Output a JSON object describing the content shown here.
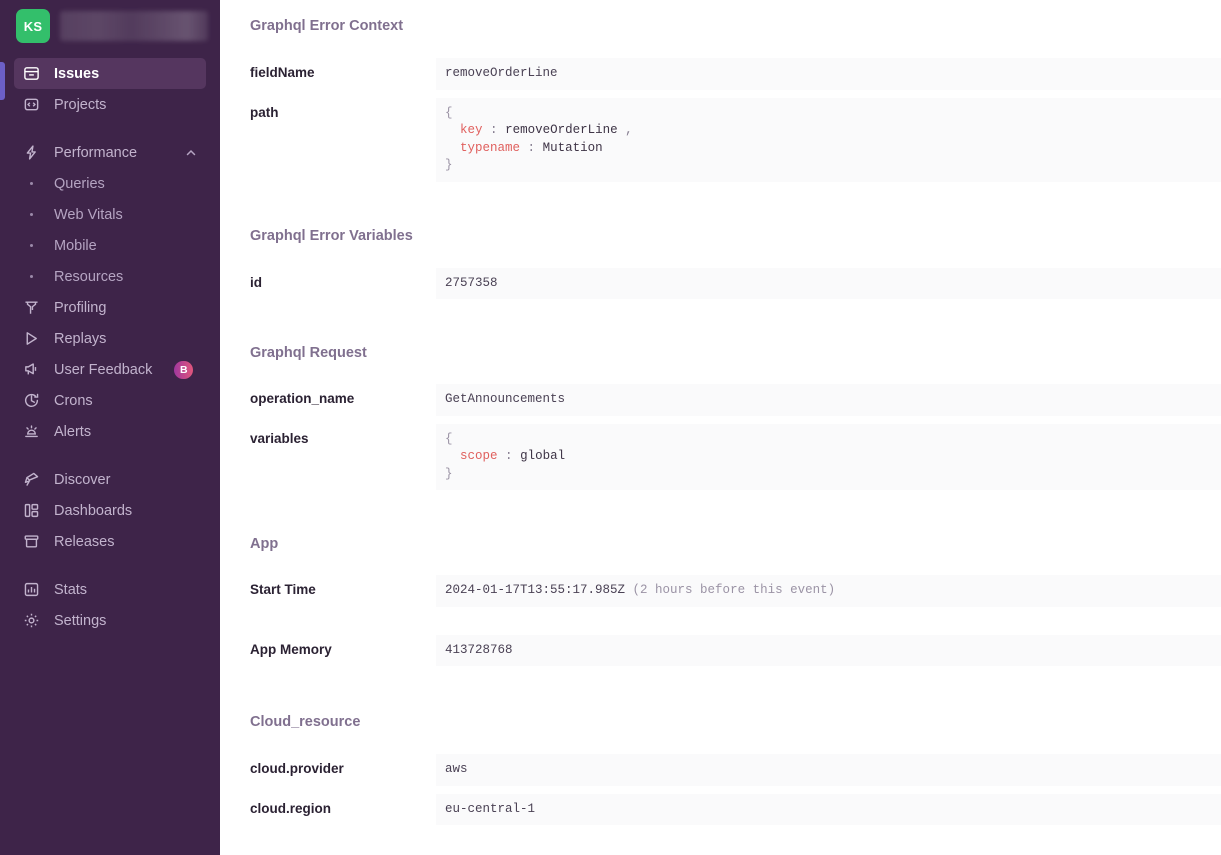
{
  "sidebar": {
    "org": {
      "initials": "KS",
      "name_redacted": ""
    },
    "items": [
      {
        "label": "Issues",
        "icon": "issues-icon",
        "active": true
      },
      {
        "label": "Projects",
        "icon": "projects-icon",
        "active": false
      },
      {
        "label": "Performance",
        "icon": "performance-icon",
        "expanded": true,
        "chevron": "chevron-up-icon"
      },
      {
        "label": "Queries",
        "sub": true
      },
      {
        "label": "Web Vitals",
        "sub": true
      },
      {
        "label": "Mobile",
        "sub": true
      },
      {
        "label": "Resources",
        "sub": true
      },
      {
        "label": "Profiling",
        "icon": "profiling-icon"
      },
      {
        "label": "Replays",
        "icon": "replays-icon"
      },
      {
        "label": "User Feedback",
        "icon": "user-feedback-icon",
        "badge": "B"
      },
      {
        "label": "Crons",
        "icon": "crons-icon"
      },
      {
        "label": "Alerts",
        "icon": "alerts-icon"
      },
      {
        "label": "Discover",
        "icon": "discover-icon"
      },
      {
        "label": "Dashboards",
        "icon": "dashboards-icon"
      },
      {
        "label": "Releases",
        "icon": "releases-icon"
      },
      {
        "label": "Stats",
        "icon": "stats-icon"
      },
      {
        "label": "Settings",
        "icon": "settings-icon"
      }
    ]
  },
  "sections": {
    "graphql_error_context": {
      "title": "Graphql Error Context",
      "field_name_key": "fieldName",
      "field_name_value": "removeOrderLine",
      "path_key": "path",
      "path_lines": {
        "open": "{",
        "l1_key": "key",
        "l1_sep": ":",
        "l1_val": "removeOrderLine",
        "l1_comma": ",",
        "l2_key": "typename",
        "l2_sep": ":",
        "l2_val": "Mutation",
        "close": "}"
      }
    },
    "graphql_error_variables": {
      "title": "Graphql Error Variables",
      "id_key": "id",
      "id_value": "2757358"
    },
    "graphql_request": {
      "title": "Graphql Request",
      "operation_name_key": "operation_name",
      "operation_name_value": "GetAnnouncements",
      "variables_key": "variables",
      "variables_lines": {
        "open": "{",
        "l1_key": "scope",
        "l1_sep": ":",
        "l1_val": "global",
        "close": "}"
      }
    },
    "app": {
      "title": "App",
      "start_time_key": "Start Time",
      "start_time_value": "2024-01-17T13:55:17.985Z",
      "start_time_note": "(2 hours before this event)",
      "app_memory_key": "App Memory",
      "app_memory_value": "413728768"
    },
    "cloud_resource": {
      "title": "Cloud_resource",
      "provider_key": "cloud.provider",
      "provider_value": "aws",
      "region_key": "cloud.region",
      "region_value": "eu-central-1"
    }
  },
  "colors": {
    "sidebar_bg": "#3e2449",
    "sidebar_active": "#55365f",
    "avatar_green": "#33bf6b",
    "accent": "#6c5fc7",
    "badge_gradient_start": "#a0389e",
    "badge_gradient_end": "#e1567c",
    "token_key": "#e0605e",
    "value_cell_bg": "#fafafb"
  }
}
